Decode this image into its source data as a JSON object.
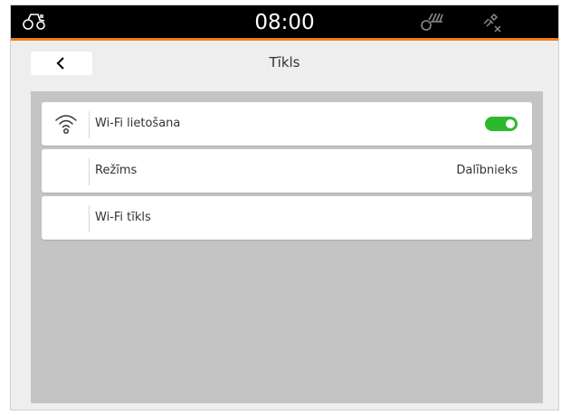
{
  "status_bar": {
    "time": "08:00",
    "icons": [
      "tractor-icon",
      "implement-icon",
      "gps-satellite-off-icon"
    ],
    "accent_color": "#f07d1a"
  },
  "header": {
    "back_icon": "chevron-left-icon",
    "title": "Tīkls"
  },
  "settings": {
    "rows": [
      {
        "icon": "wifi-icon",
        "label": "Wi-Fi lietošana",
        "toggle_on": true
      },
      {
        "label": "Režīms",
        "value": "Dalībnieks"
      },
      {
        "label": "Wi-Fi tīkls",
        "value": ""
      }
    ]
  },
  "colors": {
    "toggle_on": "#2eb82e",
    "content_bg": "#c4c4c4"
  }
}
